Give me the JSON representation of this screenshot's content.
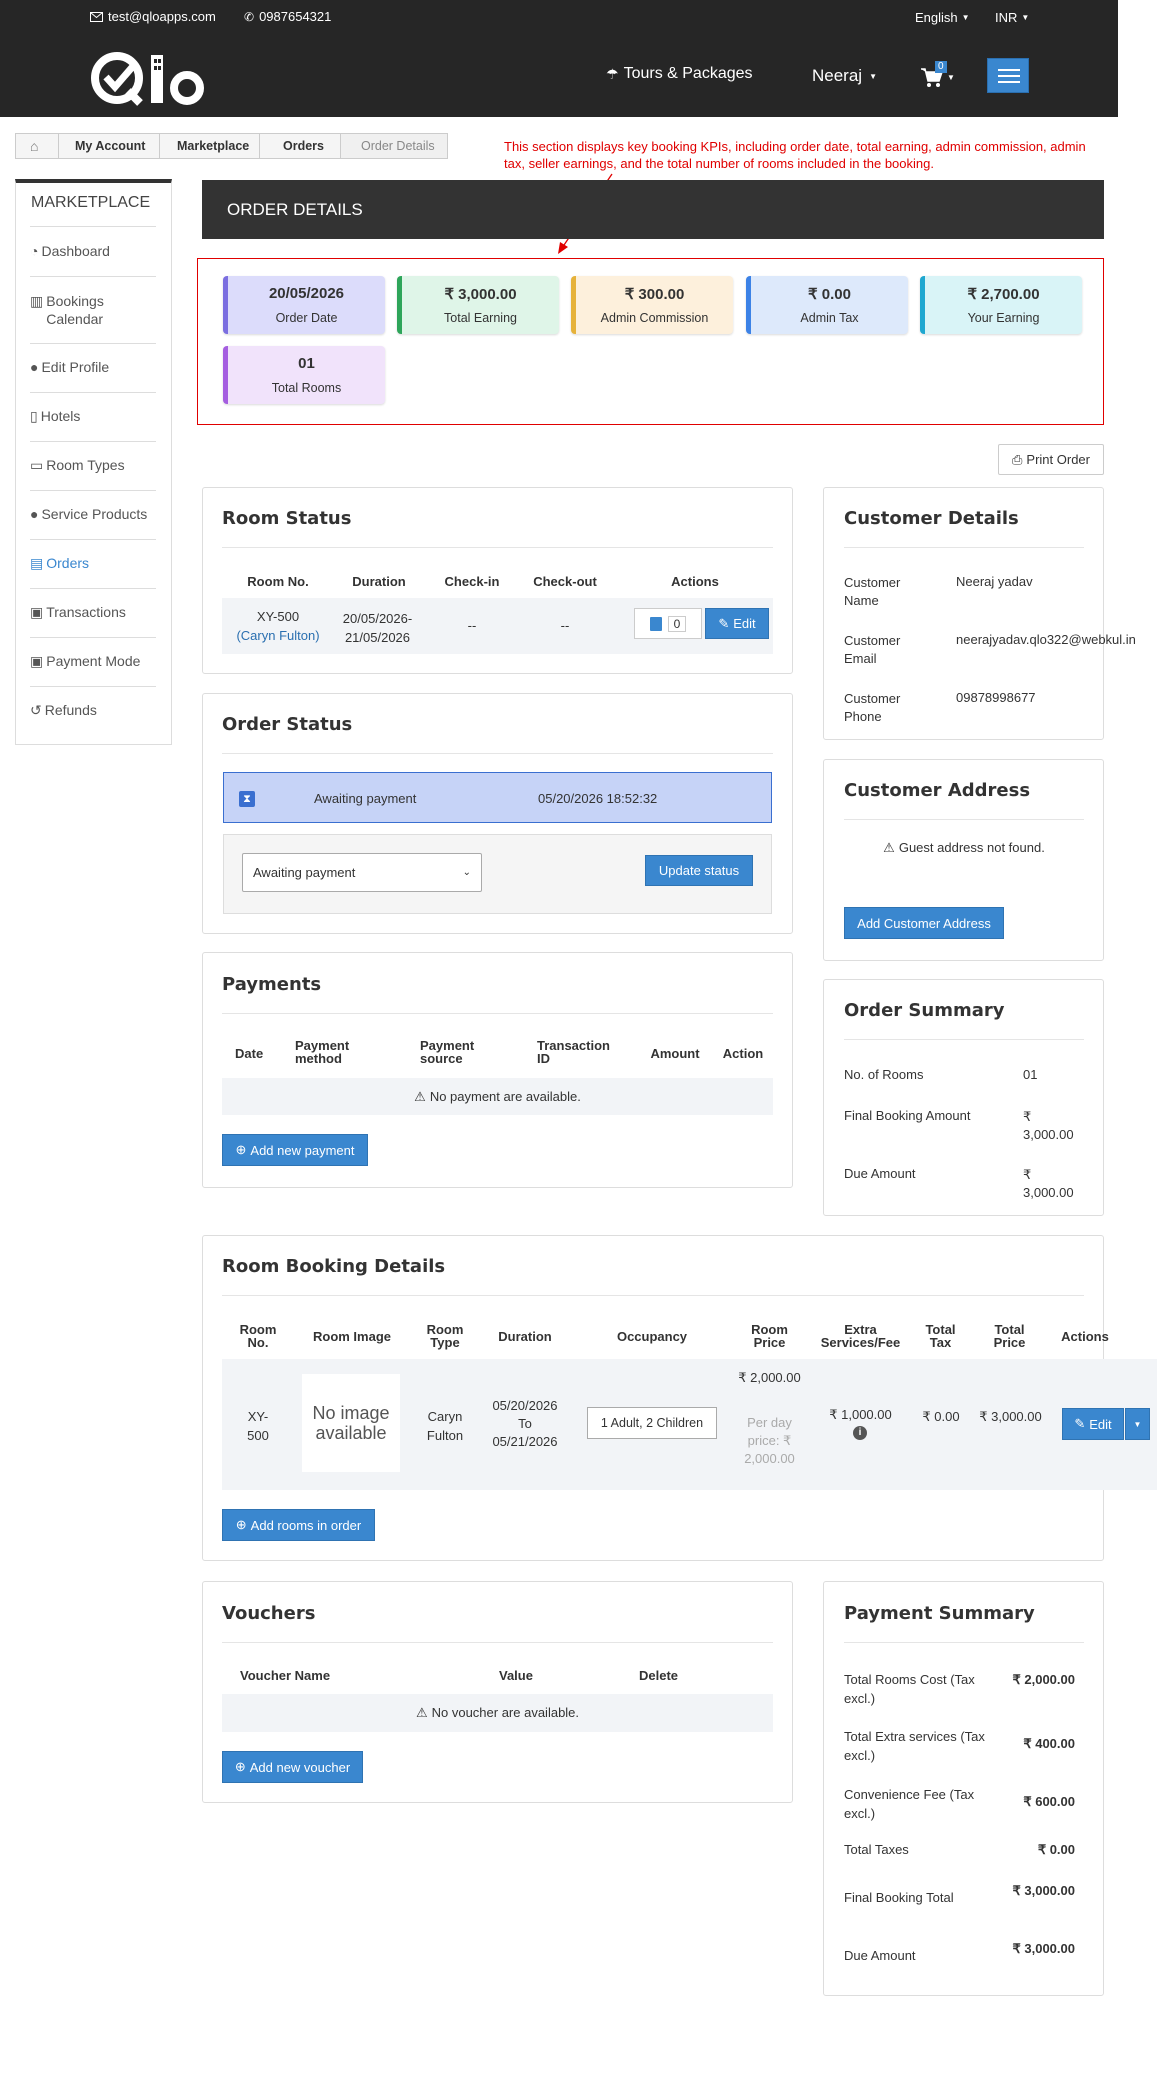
{
  "topbar": {
    "email": "test@qloapps.com",
    "phone": "0987654321",
    "language": "English",
    "currency": "INR"
  },
  "nav": {
    "logo": "Qlo",
    "tours": "Tours & Packages",
    "user": "Neeraj",
    "cart_count": "0"
  },
  "breadcrumb": [
    "My Account",
    "Marketplace",
    "Orders",
    "Order Details"
  ],
  "annotation": "This section displays key booking KPIs, including order date, total earning, admin commission, admin tax, seller earnings, and the total number of rooms included in the booking.",
  "sidebar": {
    "title": "MARKETPLACE",
    "items": [
      "Dashboard",
      "Bookings Calendar",
      "Edit Profile",
      "Hotels",
      "Room Types",
      "Service Products",
      "Orders",
      "Transactions",
      "Payment Mode",
      "Refunds"
    ]
  },
  "order_details_title": "ORDER DETAILS",
  "kpis": [
    {
      "value": "20/05/2026",
      "label": "Order Date",
      "color": "#7b6ee0",
      "bg": "#dcdcfb"
    },
    {
      "value": "₹ 3,000.00",
      "label": "Total Earning",
      "color": "#2ea55a",
      "bg": "#dff5e8"
    },
    {
      "value": "₹ 300.00",
      "label": "Admin Commission",
      "color": "#e6b23a",
      "bg": "#fdf0dc"
    },
    {
      "value": "₹ 0.00",
      "label": "Admin Tax",
      "color": "#3c82e6",
      "bg": "#dde9fb"
    },
    {
      "value": "₹ 2,700.00",
      "label": "Your Earning",
      "color": "#1fa7d0",
      "bg": "#d9f4f7"
    },
    {
      "value": "01",
      "label": "Total Rooms",
      "color": "#a55ee0",
      "bg": "#f1e3fb"
    }
  ],
  "print_order": "Print Order",
  "room_status": {
    "title": "Room Status",
    "headers": [
      "Room No.",
      "Duration",
      "Check-in",
      "Check-out",
      "Actions"
    ],
    "row": {
      "room": "XY-500",
      "guest": "(Caryn Fulton)",
      "duration": "20/05/2026-21/05/2026",
      "checkin": "--",
      "checkout": "--",
      "doc_count": "0",
      "edit": "Edit"
    }
  },
  "order_status": {
    "title": "Order Status",
    "current": "Awaiting payment",
    "date": "05/20/2026 18:52:32",
    "select_value": "Awaiting payment",
    "update_button": "Update status"
  },
  "payments": {
    "title": "Payments",
    "headers": [
      "Date",
      "Payment method",
      "Payment source",
      "Transaction ID",
      "Amount",
      "Action"
    ],
    "empty": "No payment are available.",
    "add_button": "Add new payment"
  },
  "customer": {
    "title": "Customer Details",
    "name_label": "Customer Name",
    "name": "Neeraj yadav",
    "email_label": "Customer Email",
    "email": "neerajyadav.qlo322@webkul.in",
    "phone_label": "Customer Phone",
    "phone": "09878998677"
  },
  "address": {
    "title": "Customer Address",
    "empty": "Guest address not found.",
    "add_button": "Add Customer Address"
  },
  "order_summary": {
    "title": "Order Summary",
    "rows": [
      {
        "label": "No. of Rooms",
        "value": "01"
      },
      {
        "label": "Final Booking Amount",
        "value": "₹ 3,000.00"
      },
      {
        "label": "Due Amount",
        "value": "₹ 3,000.00"
      }
    ]
  },
  "booking_details": {
    "title": "Room Booking Details",
    "headers": [
      "Room No.",
      "Room Image",
      "Room Type",
      "Duration",
      "Occupancy",
      "Room Price",
      "Extra Services/Fee",
      "Total Tax",
      "Total Price",
      "Actions"
    ],
    "row": {
      "room": "XY-500",
      "image": "No image available",
      "type": "Caryn Fulton",
      "from": "05/20/2026",
      "to_word": "To",
      "to": "05/21/2026",
      "occupancy": "1 Adult, 2 Children",
      "price": "₹ 2,000.00",
      "per_day": "Per day price: ₹ 2,000.00",
      "extra": "₹ 1,000.00",
      "tax": "₹ 0.00",
      "total": "₹ 3,000.00",
      "edit": "Edit"
    },
    "add_button": "Add rooms in order"
  },
  "vouchers": {
    "title": "Vouchers",
    "headers": [
      "Voucher Name",
      "Value",
      "Delete"
    ],
    "empty": "No voucher are available.",
    "add_button": "Add new voucher"
  },
  "payment_summary": {
    "title": "Payment Summary",
    "rows": [
      {
        "label": "Total Rooms Cost (Tax excl.)",
        "value": "₹ 2,000.00"
      },
      {
        "label": "Total Extra services (Tax excl.)",
        "value": "₹ 400.00"
      },
      {
        "label": "Convenience Fee (Tax excl.)",
        "value": "₹ 600.00"
      },
      {
        "label": "Total Taxes",
        "value": "₹ 0.00"
      },
      {
        "label": "Final Booking Total",
        "value": "₹ 3,000.00"
      },
      {
        "label": "Due Amount",
        "value": "₹ 3,000.00"
      }
    ]
  }
}
